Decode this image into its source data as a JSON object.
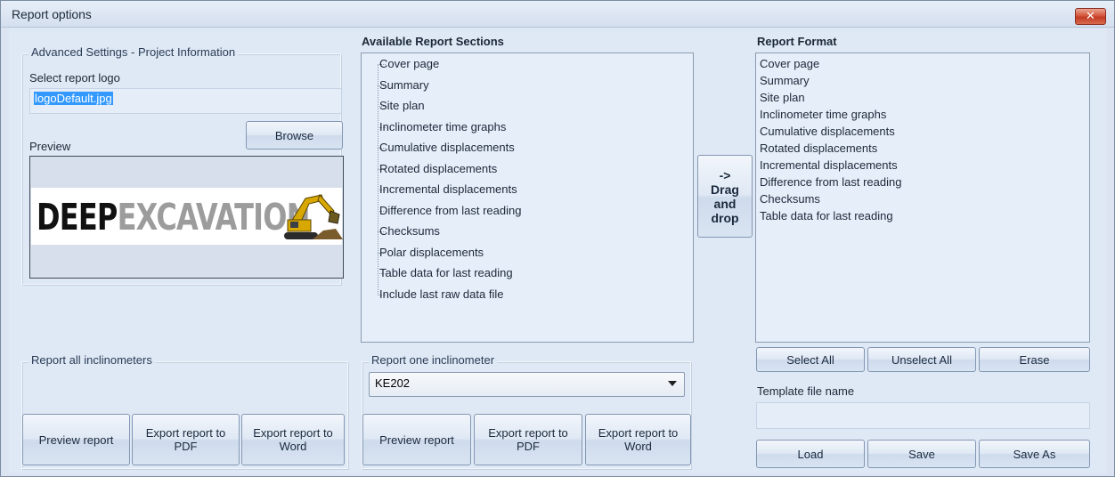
{
  "window": {
    "title": "Report options",
    "close_glyph": "✕"
  },
  "project_info": {
    "legend": "Advanced Settings - Project Information",
    "logo_label": "Select report logo",
    "logo_value": "logoDefault.jpg",
    "browse_label": "Browse",
    "preview_label": "Preview",
    "logo_image_text": {
      "part1": "DEEP",
      "part2": "EXCAVATION"
    },
    "logo_icon": "excavator-icon"
  },
  "available_sections": {
    "label": "Available Report Sections",
    "items": [
      "Cover page",
      "Summary",
      "Site plan",
      "Inclinometer time graphs",
      "Cumulative displacements",
      "Rotated displacements",
      "Incremental displacements",
      "Difference from last reading",
      "Checksums",
      "Polar displacements",
      "Table data for last reading",
      "Include last raw data file"
    ]
  },
  "drag_drop": {
    "arrow": "->",
    "line1": "Drag",
    "line2": "and",
    "line3": "drop"
  },
  "report_format": {
    "label": "Report Format",
    "items": [
      "Cover page",
      "Summary",
      "Site plan",
      "Inclinometer time graphs",
      "Cumulative displacements",
      "Rotated displacements",
      "Incremental displacements",
      "Difference from last reading",
      "Checksums",
      "Table data for last reading"
    ],
    "select_all": "Select All",
    "unselect_all": "Unselect All",
    "erase": "Erase",
    "template_label": "Template file name",
    "template_value": "",
    "load": "Load",
    "save": "Save",
    "save_as": "Save As"
  },
  "report_all": {
    "legend": "Report all inclinometers",
    "preview": "Preview report",
    "export_pdf_1": "Export report to",
    "export_pdf_2": "PDF",
    "export_word_1": "Export report to",
    "export_word_2": "Word"
  },
  "report_one": {
    "legend": "Report one inclinometer",
    "selected": "KE202",
    "preview": "Preview report",
    "export_pdf_1": "Export report to",
    "export_pdf_2": "PDF",
    "export_word_1": "Export report to",
    "export_word_2": "Word"
  }
}
